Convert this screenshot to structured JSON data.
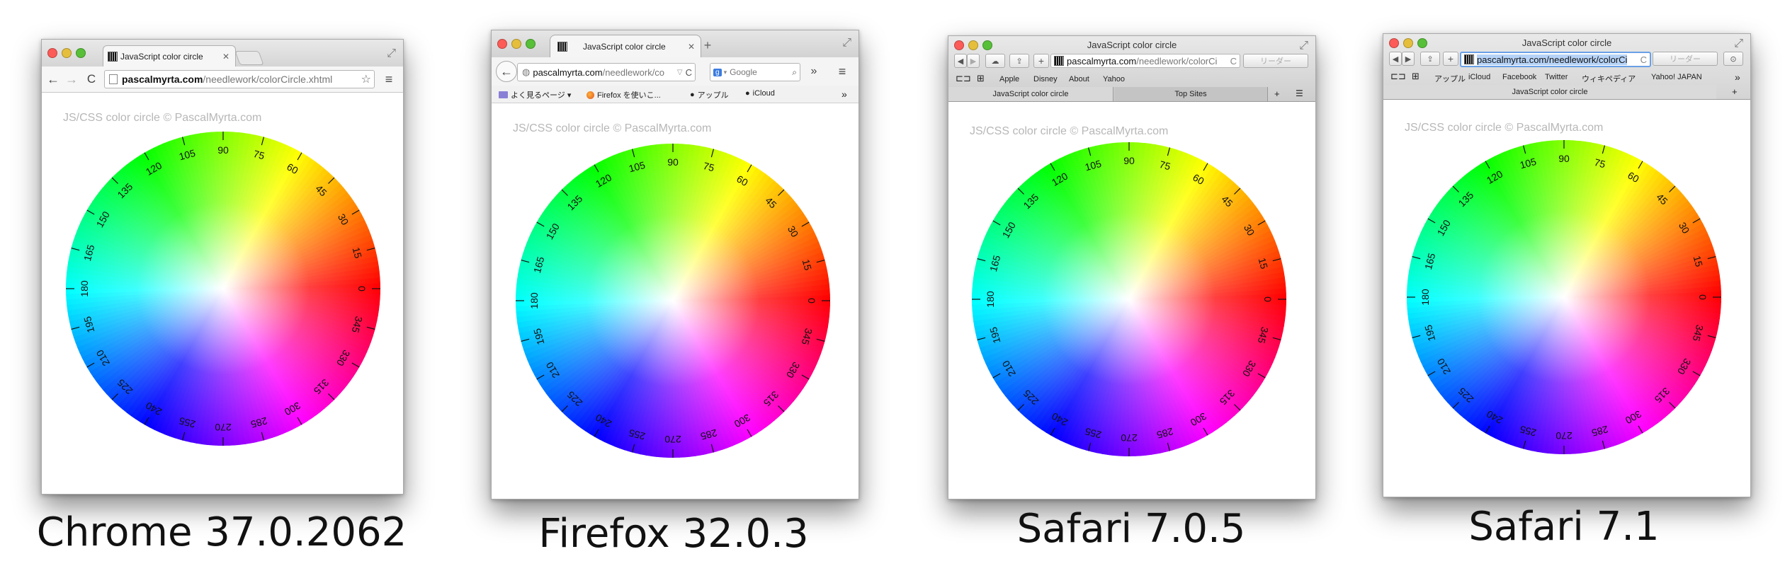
{
  "wheel_labels": [
    "0",
    "15",
    "30",
    "45",
    "60",
    "75",
    "90",
    "105",
    "120",
    "135",
    "150",
    "165",
    "180",
    "195",
    "210",
    "225",
    "240",
    "255",
    "270",
    "285",
    "300",
    "315",
    "330",
    "345"
  ],
  "watermark": "JS/CSS color circle © PascalMyrta.com",
  "chrome": {
    "caption": "Chrome 37.0.2062",
    "tab_title": "JavaScript color circle",
    "url_domain": "pascalmyrta.com",
    "url_path": "/needlework/colorCircle.xhtml"
  },
  "firefox": {
    "caption": "Firefox 32.0.3",
    "tab_title": "JavaScript color circle",
    "url_domain": "pascalmyrta.com",
    "url_path": "/needlework/co",
    "search_placeholder": "Google",
    "bookmarks": [
      "よく見るページ ▾",
      "Firefox を使いこ...",
      "アップル",
      "iCloud"
    ]
  },
  "safari705": {
    "caption": "Safari 7.0.5",
    "window_title": "JavaScript color circle",
    "url_domain": "pascalmyrta.com",
    "url_path": "/needlework/colorCi",
    "reader_label": "リーダー",
    "bookmarks": [
      "Apple",
      "Disney",
      "About",
      "Yahoo"
    ],
    "tabs": [
      "JavaScript color circle",
      "Top Sites"
    ]
  },
  "safari71": {
    "caption": "Safari 7.1",
    "window_title": "JavaScript color circle",
    "url_text": "pascalmyrta.com/needlework/colorCi",
    "reader_label": "リーダー",
    "bookmarks": [
      "アップル",
      "iCloud",
      "Facebook",
      "Twitter",
      "ウィキペディア",
      "Yahoo! JAPAN"
    ],
    "tab_title": "JavaScript color circle"
  }
}
